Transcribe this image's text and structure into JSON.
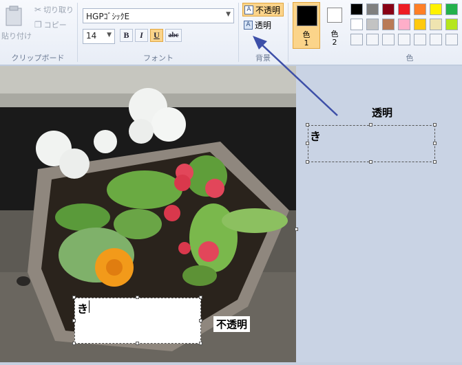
{
  "clipboard": {
    "paste_label": "貼り付け",
    "cut_label": "切り取り",
    "copy_label": "コピー",
    "group_label": "クリップボード"
  },
  "font": {
    "name_value": "HGPｺﾞｼｯｸE",
    "size_value": "14",
    "bold": "B",
    "italic": "I",
    "underline": "U",
    "strike": "abc",
    "group_label": "フォント"
  },
  "background": {
    "opaque_label": "不透明",
    "transparent_label": "透明",
    "group_label": "背景"
  },
  "colors": {
    "color1_label": "色",
    "color1_num": "1",
    "color2_label": "色",
    "color2_num": "2",
    "group_label": "色",
    "color1": "#000000",
    "color2": "#ffffff",
    "accent": "#f7b23b",
    "palette_row1": [
      "#000000",
      "#7f7f7f",
      "#880015",
      "#ed1c24",
      "#ff7f27",
      "#fff200",
      "#22b14c"
    ],
    "palette_row2": [
      "#ffffff",
      "#c3c3c3",
      "#b97a57",
      "#ffaec9",
      "#ffc90e",
      "#efe4b0",
      "#b5e61d"
    ]
  },
  "canvas": {
    "textbox_bottom_char": "き",
    "caption_opaque": "不透明"
  },
  "annotation": {
    "title": "透明",
    "textbox_char": "き"
  }
}
